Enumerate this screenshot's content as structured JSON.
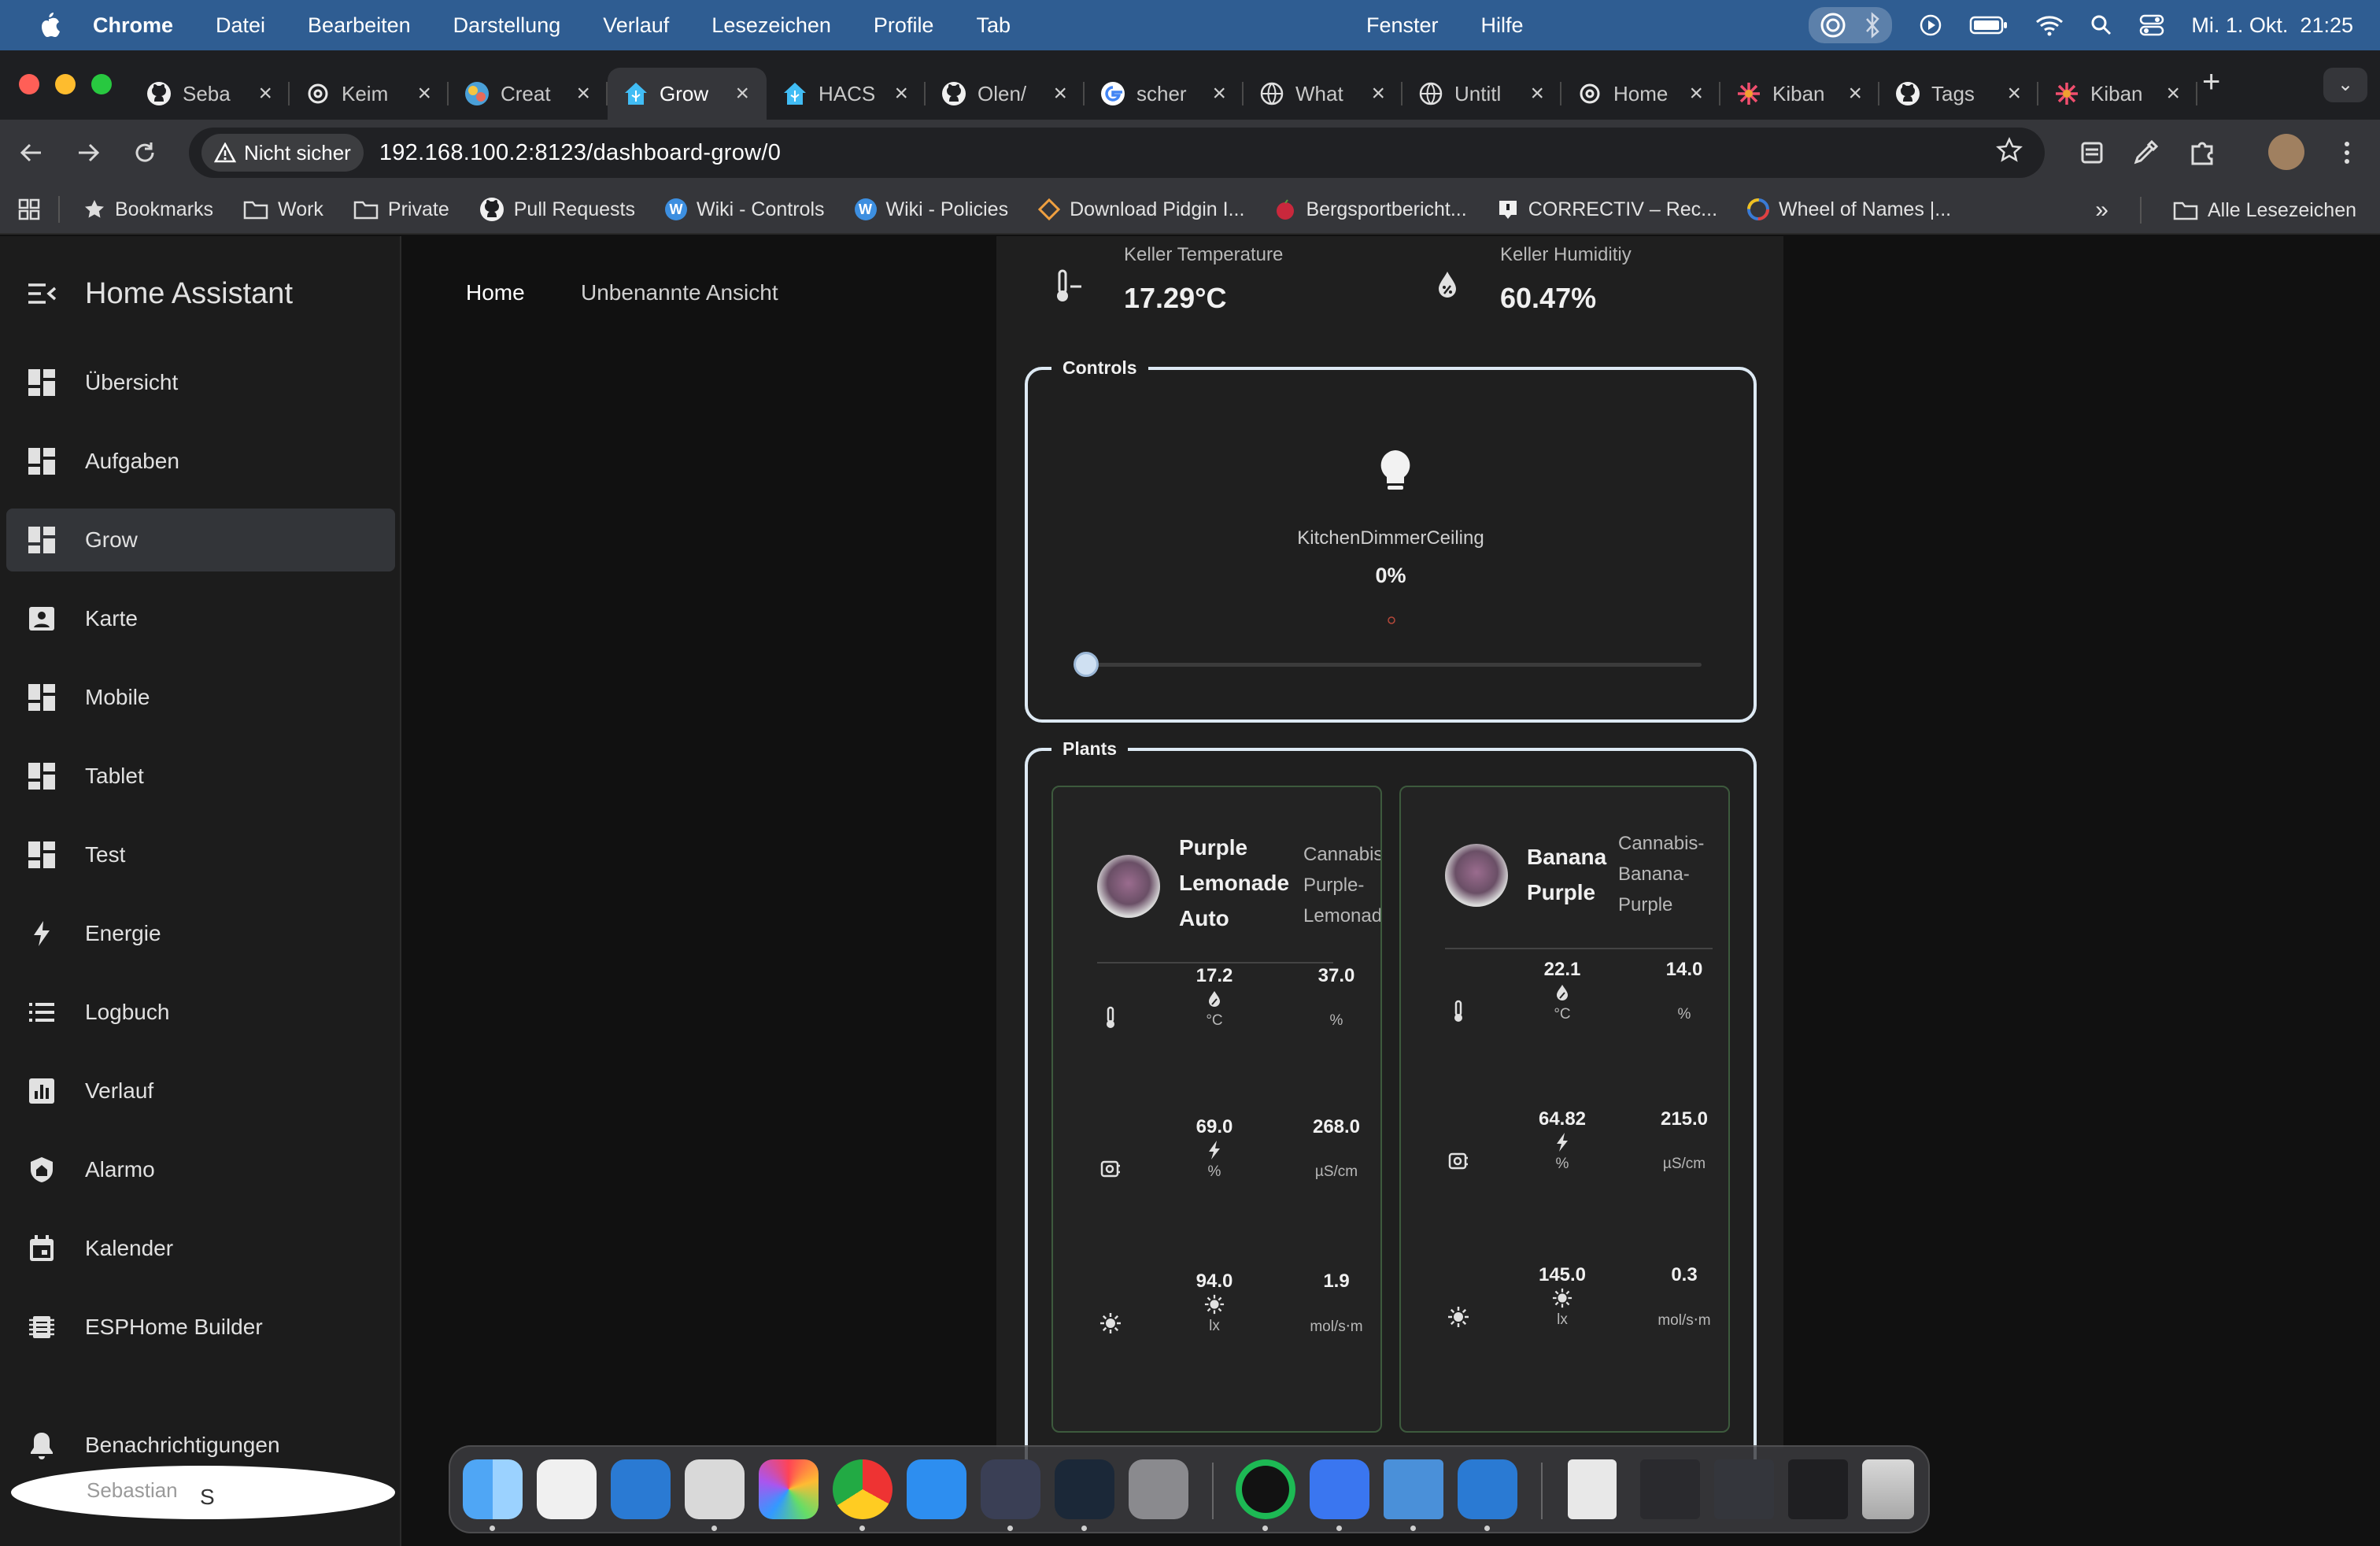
{
  "menubar": {
    "app": "Chrome",
    "menus": [
      "Datei",
      "Bearbeiten",
      "Darstellung",
      "Verlauf",
      "Lesezeichen",
      "Profile",
      "Tab"
    ],
    "menus_right": [
      "Fenster",
      "Hilfe"
    ],
    "datetime": "Mi. 1. Okt.  21:25"
  },
  "tabs": [
    {
      "title": "Seba",
      "icon": "github-icon"
    },
    {
      "title": "Keim",
      "icon": "openai-icon"
    },
    {
      "title": "Creat",
      "icon": "creative-icon"
    },
    {
      "title": "Grow",
      "icon": "home-assistant-icon",
      "active": true
    },
    {
      "title": "HACS",
      "icon": "home-assistant-icon"
    },
    {
      "title": "Olen/",
      "icon": "github-icon"
    },
    {
      "title": "scher",
      "icon": "google-icon"
    },
    {
      "title": "What",
      "icon": "globe-icon"
    },
    {
      "title": "Untitl",
      "icon": "globe-icon"
    },
    {
      "title": "Home",
      "icon": "openai-icon"
    },
    {
      "title": "Kiban",
      "icon": "kibana-icon"
    },
    {
      "title": "Tags",
      "icon": "github-icon"
    },
    {
      "title": "Kiban",
      "icon": "kibana-icon"
    }
  ],
  "address": {
    "security_label": "Nicht sicher",
    "url": "192.168.100.2:8123/dashboard-grow/0"
  },
  "bookmarks": {
    "items": [
      {
        "label": "Bookmarks",
        "icon": "star-icon"
      },
      {
        "label": "Work",
        "icon": "folder-icon"
      },
      {
        "label": "Private",
        "icon": "folder-icon"
      },
      {
        "label": "Pull Requests",
        "icon": "github-icon"
      },
      {
        "label": "Wiki - Controls",
        "icon": "wiki-icon"
      },
      {
        "label": "Wiki - Policies",
        "icon": "wiki-icon"
      },
      {
        "label": "Download Pidgin I...",
        "icon": "pidgin-icon"
      },
      {
        "label": "Bergsportbericht...",
        "icon": "apple-red-icon"
      },
      {
        "label": "CORRECTIV – Rec...",
        "icon": "correctiv-icon"
      },
      {
        "label": "Wheel of Names |...",
        "icon": "wheel-icon"
      }
    ],
    "all_label": "Alle Lesezeichen"
  },
  "sidebar": {
    "title": "Home Assistant",
    "items": [
      {
        "label": "Übersicht",
        "icon": "dashboard-icon"
      },
      {
        "label": "Aufgaben",
        "icon": "dashboard-icon"
      },
      {
        "label": "Grow",
        "icon": "dashboard-icon",
        "active": true
      },
      {
        "label": "Karte",
        "icon": "map-icon"
      },
      {
        "label": "Mobile",
        "icon": "dashboard-icon"
      },
      {
        "label": "Tablet",
        "icon": "dashboard-icon"
      },
      {
        "label": "Test",
        "icon": "dashboard-icon"
      },
      {
        "label": "Energie",
        "icon": "lightning-icon"
      },
      {
        "label": "Logbuch",
        "icon": "list-icon"
      },
      {
        "label": "Verlauf",
        "icon": "chart-icon"
      },
      {
        "label": "Alarmo",
        "icon": "shield-icon"
      },
      {
        "label": "Kalender",
        "icon": "calendar-icon"
      },
      {
        "label": "ESPHome Builder",
        "icon": "chip-icon"
      }
    ],
    "notifications": "Benachrichtigungen",
    "user_name": "Sebastian",
    "user_initial": "S"
  },
  "views": {
    "home": "Home",
    "unnamed": "Unbenannte Ansicht"
  },
  "sensors": {
    "temperature": {
      "label": "Keller Temperature",
      "value": "17.29°C"
    },
    "humidity": {
      "label": "Keller Humiditiy",
      "value": "60.47%"
    }
  },
  "controls": {
    "legend": "Controls",
    "light_name": "KitchenDimmerCeiling",
    "brightness": "0%",
    "brightness_fraction": 0
  },
  "plants": {
    "legend": "Plants",
    "cards": [
      {
        "name_lines": [
          "Purple",
          "Lemonade",
          "Auto"
        ],
        "species_lines": [
          "Cannabis-",
          "Purple-",
          "Lemonad"
        ],
        "rows": [
          {
            "icon": "thermometer-icon",
            "val1": "17.2",
            "unit1": "°C",
            "mid_icon": "water-percent-icon",
            "val2": "37.0",
            "unit2": "%"
          },
          {
            "icon": "moisture-sensor-icon",
            "val1": "69.0",
            "unit1": "%",
            "mid_icon": "flash-icon",
            "val2": "268.0",
            "unit2": "µS/cm"
          },
          {
            "icon": "sun-icon",
            "val1": "94.0",
            "unit1": "lx",
            "mid_icon": "sun-icon",
            "val2": "1.9",
            "unit2": "mol/s⋅m"
          }
        ]
      },
      {
        "name_lines": [
          "Banana",
          "Purple"
        ],
        "species_lines": [
          "Cannabis-",
          "Banana-",
          "Purple"
        ],
        "rows": [
          {
            "icon": "thermometer-icon",
            "val1": "22.1",
            "unit1": "°C",
            "mid_icon": "water-percent-icon",
            "val2": "14.0",
            "unit2": "%"
          },
          {
            "icon": "moisture-sensor-icon",
            "val1": "64.82",
            "unit1": "%",
            "mid_icon": "flash-icon",
            "val2": "215.0",
            "unit2": "µS/cm"
          },
          {
            "icon": "sun-icon",
            "val1": "145.0",
            "unit1": "lx",
            "mid_icon": "sun-icon",
            "val2": "0.3",
            "unit2": "mol/s⋅m"
          }
        ]
      }
    ]
  },
  "dock": [
    "Finder",
    "Launchpad",
    "Visual Studio Code",
    "Parallels",
    "Fotos",
    "Chrome",
    "App Store",
    "Setapp",
    "Steam",
    "Systemeinstellungen",
    "Spotify",
    "Signal",
    "Bildschirm",
    "Visual Studio Code",
    "Dokument",
    "Fenster",
    "Fenster",
    "Fenster",
    "Papierkorb"
  ],
  "colors": {
    "menubar": "#2f5d92",
    "sidebar_bg": "#1c1c1c",
    "card_bg": "#1f1f1f",
    "card_border": "#dde9f3",
    "plant_border": "#3d5a3d",
    "slider_thumb": "#cfe0f2"
  }
}
